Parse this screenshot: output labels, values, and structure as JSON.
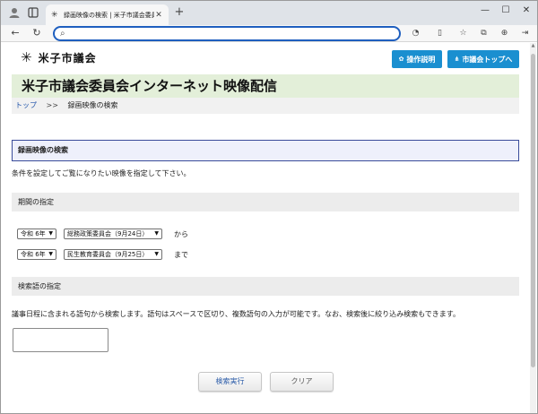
{
  "browser": {
    "tab_title": "録画映像の検索 | 米子市議会委員会",
    "tab_close": "✕",
    "new_tab": "+",
    "address_value": "",
    "icons": [
      "profile-icon",
      "workspaces-icon",
      "page-favicon",
      "back-icon",
      "refresh-icon",
      "search-icon",
      "translate-icon",
      "split-screen-icon",
      "favorites-star-icon",
      "collections-icon",
      "settings-more-icon",
      "minimize-icon",
      "maximize-icon",
      "close-window-icon"
    ]
  },
  "header": {
    "logo_text": "米子市議会",
    "btn_manual": "操作説明",
    "btn_top": "市議会トップへ",
    "accent_color": "#1a8fd0"
  },
  "banner": {
    "title": "米子市議会委員会インターネット映像配信",
    "bg_color": "#e3efd9"
  },
  "breadcrumb": {
    "home": "トップ",
    "separator": ">>",
    "current": "録画映像の検索"
  },
  "search": {
    "section_title": "録画映像の検索",
    "description": "条件を設定してご覧になりたい映像を指定して下さい。"
  },
  "period": {
    "title": "期間の指定",
    "from": {
      "era": "令和 6年",
      "meeting": "総務政策委員会（9月24日）",
      "suffix": "から"
    },
    "to": {
      "era": "令和 6年",
      "meeting": "民生教育委員会（9月25日）",
      "suffix": "まで"
    }
  },
  "keyword": {
    "title": "検索語の指定",
    "description": "議事日程に含まれる語句から検索します。語句はスペースで区切り、複数語句の入力が可能です。なお、検索後に絞り込み検索もできます。",
    "value": ""
  },
  "actions": {
    "execute": "検索実行",
    "clear": "クリア"
  }
}
